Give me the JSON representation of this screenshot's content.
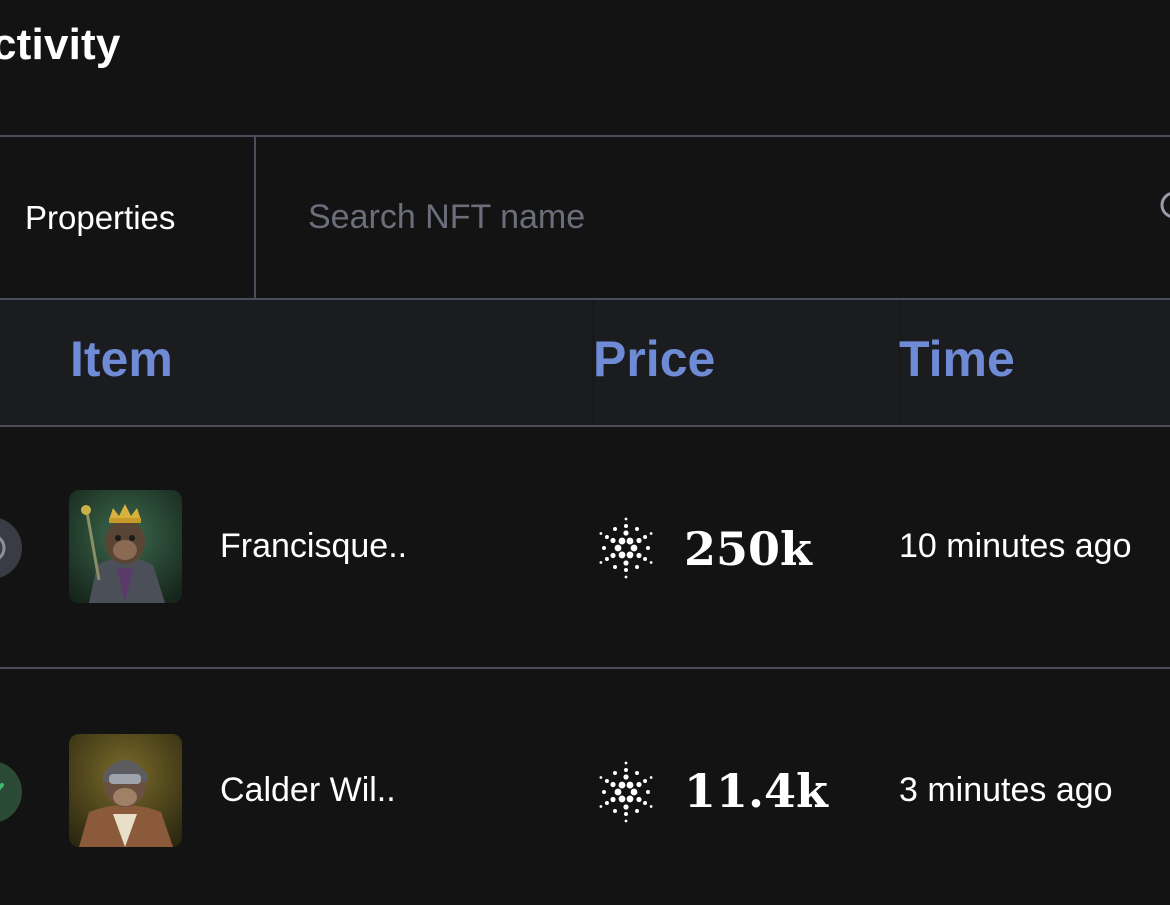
{
  "header": {
    "title": "ctivity"
  },
  "filters": {
    "properties_label": "Properties",
    "search_placeholder": "Search NFT name"
  },
  "table": {
    "columns": {
      "item": "Item",
      "price": "Price",
      "time": "Time"
    },
    "rows": [
      {
        "name": "Francisque..",
        "price": "250k",
        "time": "10 minutes ago",
        "status": "circle-status-icon",
        "thumbnail": "ape-king-crown-thumbnail"
      },
      {
        "name": "Calder Wil..",
        "price": "11.4k",
        "time": "3 minutes ago",
        "status": "check-status-icon",
        "thumbnail": "ape-pilot-helmet-thumbnail"
      }
    ]
  },
  "colors": {
    "background": "#131314",
    "header_background": "#1b1c20",
    "divider": "#4b4d5a",
    "column_heading": "#6f8bd6",
    "placeholder": "#6c6e7a",
    "success": "#3fb871"
  },
  "icons": {
    "currency": "cardano-ada-icon",
    "search": "search-icon"
  }
}
